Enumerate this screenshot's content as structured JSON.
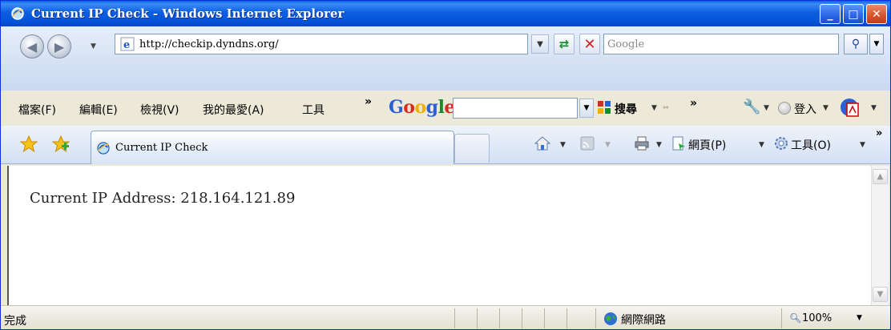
{
  "window": {
    "title": "Current IP Check - Windows Internet Explorer",
    "controls": {
      "minimize": "_",
      "maximize": "□",
      "close": "✕"
    }
  },
  "address_bar": {
    "url": "http://checkip.dyndns.org/",
    "search_placeholder": "Google"
  },
  "menu": {
    "items": [
      "檔案(F)",
      "編輯(E)",
      "檢視(V)",
      "我的最愛(A)",
      "工具"
    ],
    "overflow": "»"
  },
  "google_toolbar": {
    "logo_letters": [
      "G",
      "o",
      "o",
      "g",
      "l",
      "e"
    ],
    "search_label": "搜尋",
    "overflow": "»",
    "login_label": "登入"
  },
  "tabs": [
    {
      "title": "Current IP Check"
    }
  ],
  "command_bar": {
    "page_label": "網頁(P)",
    "tools_label": "工具(O)",
    "overflow": "»"
  },
  "content": {
    "text": "Current IP Address: 218.164.121.89"
  },
  "status_bar": {
    "status": "完成",
    "zone": "網際網路",
    "zoom": "100%"
  },
  "colors": {
    "titlebar": "#0553d9",
    "google_blue": "#2a5fd6",
    "google_red": "#d62d20",
    "google_yellow": "#f1b000",
    "google_green": "#198a2d"
  }
}
